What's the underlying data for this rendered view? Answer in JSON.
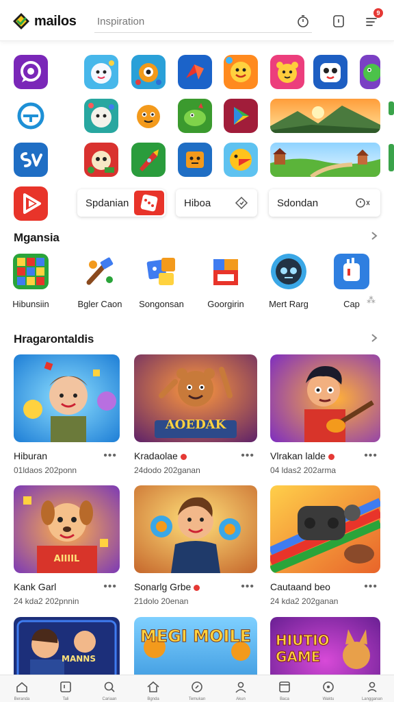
{
  "header": {
    "logo_text": "mailos",
    "search_placeholder": "Inspiration",
    "notification_count": "9"
  },
  "chips": [
    {
      "label": "Spdanian"
    },
    {
      "label": "Hiboa"
    },
    {
      "label": "Sdondan"
    }
  ],
  "section_categories": {
    "title": "Mgansia",
    "items": [
      {
        "label": "Hibunsiin"
      },
      {
        "label": "Bgler Caon"
      },
      {
        "label": "Songonsan"
      },
      {
        "label": "Goorgirin"
      },
      {
        "label": "Mert Rarg"
      },
      {
        "label": "Cap"
      }
    ]
  },
  "section_featured": {
    "title": "Hragarontaldis",
    "cards": [
      {
        "title": "Hiburan",
        "subtitle": "01ldaos 202ponn",
        "verified": false,
        "art_text": ""
      },
      {
        "title": "Kradaolae",
        "subtitle": "24dodo 202ganan",
        "verified": true,
        "art_text": "AOEDAK"
      },
      {
        "title": "Vlrakan lalde",
        "subtitle": "04 ldas2 202arma",
        "verified": true,
        "art_text": ""
      },
      {
        "title": "Kank Garl",
        "subtitle": "24 kda2 202pnnin",
        "verified": false,
        "art_text": "AIIIIL"
      },
      {
        "title": "Sonarlg Grbe",
        "subtitle": "21dolo 20enan",
        "verified": true,
        "art_text": ""
      },
      {
        "title": "Cautaand beo",
        "subtitle": "24 kda2 202ganan",
        "verified": false,
        "art_text": ""
      },
      {
        "title": "",
        "subtitle": "",
        "verified": false,
        "art_text": "MANNS"
      },
      {
        "title": "",
        "subtitle": "",
        "verified": false,
        "art_text": "MEGI MOILE"
      },
      {
        "title": "",
        "subtitle": "",
        "verified": false,
        "art_text": "HIUTIO GAME"
      }
    ]
  },
  "bottom_nav": [
    {
      "icon": "home-icon",
      "label": "Beranda"
    },
    {
      "icon": "bookmark-icon",
      "label": "Tali"
    },
    {
      "icon": "search-icon",
      "label": "Cariaan"
    },
    {
      "icon": "house-icon",
      "label": "Bgnda"
    },
    {
      "icon": "compass-icon",
      "label": "Temukan"
    },
    {
      "icon": "user-icon",
      "label": "Akun"
    },
    {
      "icon": "book-icon",
      "label": "Baca"
    },
    {
      "icon": "clock-icon",
      "label": "Waktu"
    },
    {
      "icon": "profile-icon",
      "label": "Langganan"
    }
  ],
  "colors": {
    "accent": "#e53935",
    "text": "#1b1b1b"
  }
}
